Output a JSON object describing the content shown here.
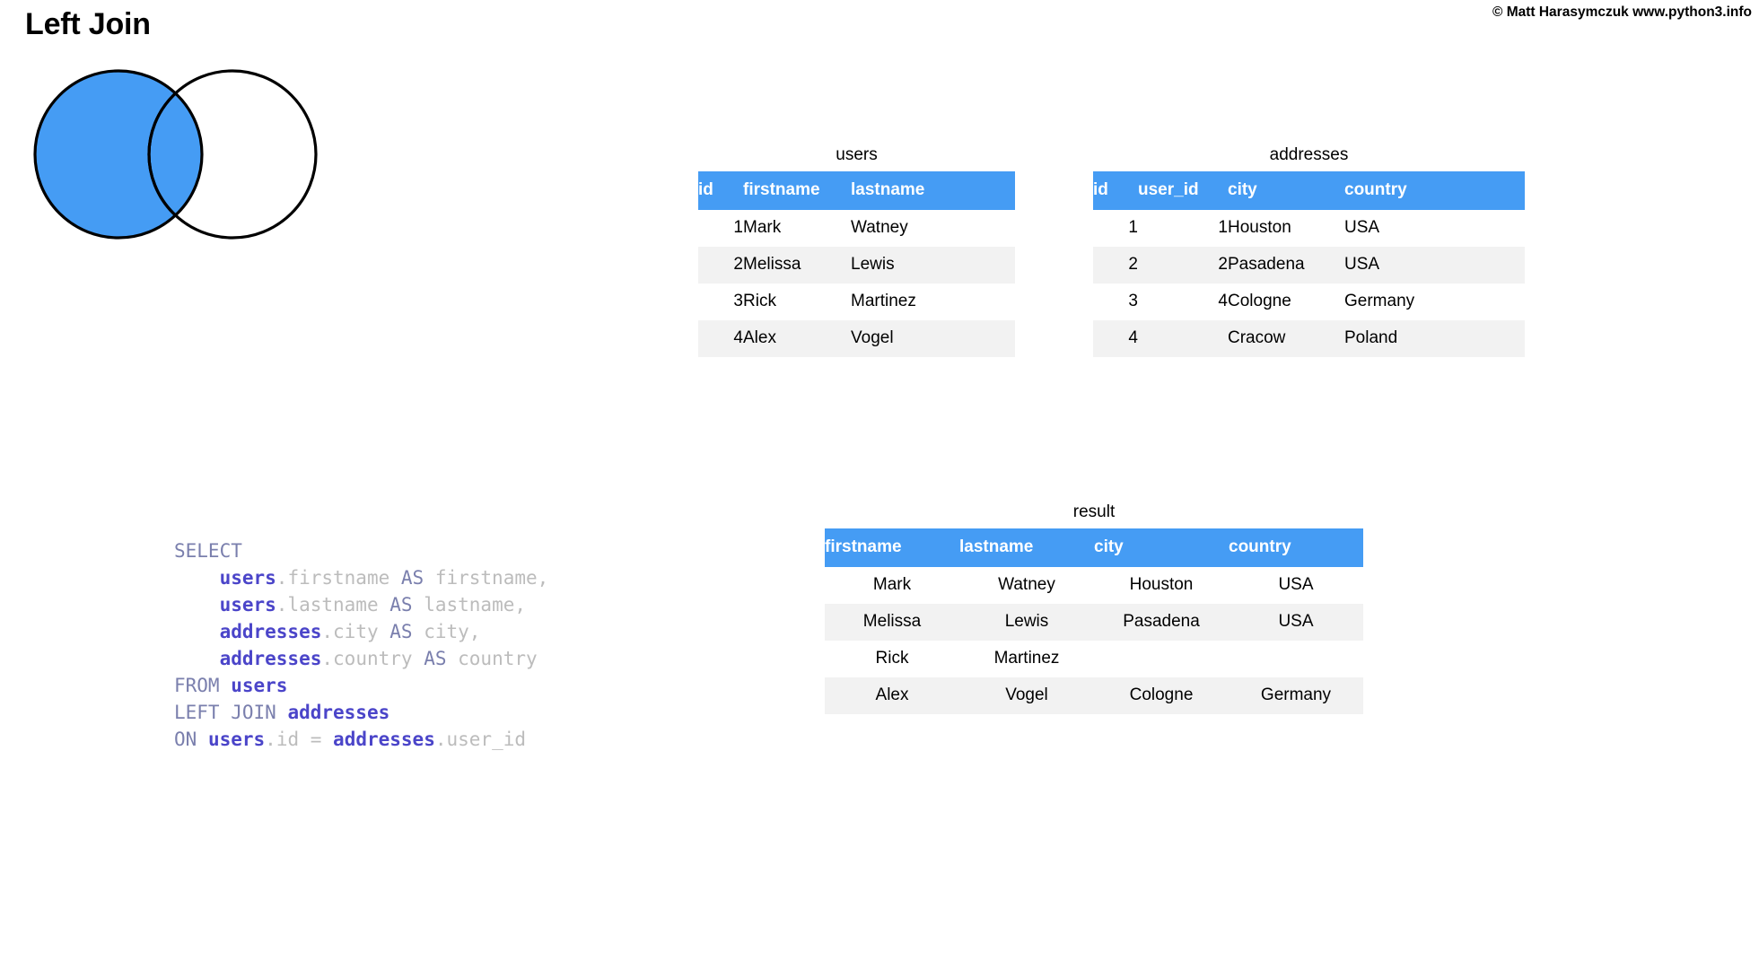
{
  "page": {
    "title": "Left Join",
    "copyright": "© Matt Harasymczuk www.python3.info",
    "background": "#ffffff"
  },
  "colors": {
    "accent_blue": "#459cf4",
    "venn_fill": "#459cf4",
    "venn_stroke": "#000000",
    "row_alt": "#f2f2f2",
    "sql_keyword": "#7a7fad",
    "sql_table": "#4b45c9",
    "sql_column": "#bcbcbc"
  },
  "venn": {
    "name": "left-join-venn-diagram",
    "left_circle_filled": true,
    "right_circle_filled": false,
    "intersection_filled": true
  },
  "tables": {
    "users": {
      "caption": "users",
      "columns": [
        "id",
        "firstname",
        "lastname"
      ],
      "rows": [
        [
          "1",
          "Mark",
          "Watney"
        ],
        [
          "2",
          "Melissa",
          "Lewis"
        ],
        [
          "3",
          "Rick",
          "Martinez"
        ],
        [
          "4",
          "Alex",
          "Vogel"
        ]
      ]
    },
    "addresses": {
      "caption": "addresses",
      "columns": [
        "id",
        "user_id",
        "city",
        "country"
      ],
      "rows": [
        [
          "1",
          "1",
          "Houston",
          "USA"
        ],
        [
          "2",
          "2",
          "Pasadena",
          "USA"
        ],
        [
          "3",
          "4",
          "Cologne",
          "Germany"
        ],
        [
          "4",
          "",
          "Cracow",
          "Poland"
        ]
      ]
    },
    "result": {
      "caption": "result",
      "columns": [
        "firstname",
        "lastname",
        "city",
        "country"
      ],
      "rows": [
        [
          "Mark",
          "Watney",
          "Houston",
          "USA"
        ],
        [
          "Melissa",
          "Lewis",
          "Pasadena",
          "USA"
        ],
        [
          "Rick",
          "Martinez",
          "",
          ""
        ],
        [
          "Alex",
          "Vogel",
          "Cologne",
          "Germany"
        ]
      ]
    }
  },
  "sql": {
    "lines": [
      [
        {
          "t": "SELECT",
          "c": "kw"
        }
      ],
      [
        {
          "t": "    ",
          "c": "col"
        },
        {
          "t": "users",
          "c": "tbl"
        },
        {
          "t": ".",
          "c": "punct"
        },
        {
          "t": "firstname",
          "c": "col"
        },
        {
          "t": " ",
          "c": "col"
        },
        {
          "t": "AS",
          "c": "kw"
        },
        {
          "t": " firstname,",
          "c": "col"
        }
      ],
      [
        {
          "t": "    ",
          "c": "col"
        },
        {
          "t": "users",
          "c": "tbl"
        },
        {
          "t": ".",
          "c": "punct"
        },
        {
          "t": "lastname",
          "c": "col"
        },
        {
          "t": " ",
          "c": "col"
        },
        {
          "t": "AS",
          "c": "kw"
        },
        {
          "t": " lastname,",
          "c": "col"
        }
      ],
      [
        {
          "t": "    ",
          "c": "col"
        },
        {
          "t": "addresses",
          "c": "tbl"
        },
        {
          "t": ".",
          "c": "punct"
        },
        {
          "t": "city",
          "c": "col"
        },
        {
          "t": " ",
          "c": "col"
        },
        {
          "t": "AS",
          "c": "kw"
        },
        {
          "t": " city,",
          "c": "col"
        }
      ],
      [
        {
          "t": "    ",
          "c": "col"
        },
        {
          "t": "addresses",
          "c": "tbl"
        },
        {
          "t": ".",
          "c": "punct"
        },
        {
          "t": "country",
          "c": "col"
        },
        {
          "t": " ",
          "c": "col"
        },
        {
          "t": "AS",
          "c": "kw"
        },
        {
          "t": " country",
          "c": "col"
        }
      ],
      [
        {
          "t": "FROM ",
          "c": "kw"
        },
        {
          "t": "users",
          "c": "tbl"
        }
      ],
      [
        {
          "t": "LEFT JOIN ",
          "c": "kw"
        },
        {
          "t": "addresses",
          "c": "tbl"
        }
      ],
      [
        {
          "t": "ON ",
          "c": "kw"
        },
        {
          "t": "users",
          "c": "tbl"
        },
        {
          "t": ".",
          "c": "punct"
        },
        {
          "t": "id",
          "c": "col"
        },
        {
          "t": " = ",
          "c": "op"
        },
        {
          "t": "addresses",
          "c": "tbl"
        },
        {
          "t": ".",
          "c": "punct"
        },
        {
          "t": "user_id",
          "c": "col"
        }
      ]
    ],
    "plain_text": "SELECT\n    users.firstname AS firstname,\n    users.lastname AS lastname,\n    addresses.city AS city,\n    addresses.country AS country\nFROM users\nLEFT JOIN addresses\nON users.id = addresses.user_id"
  }
}
